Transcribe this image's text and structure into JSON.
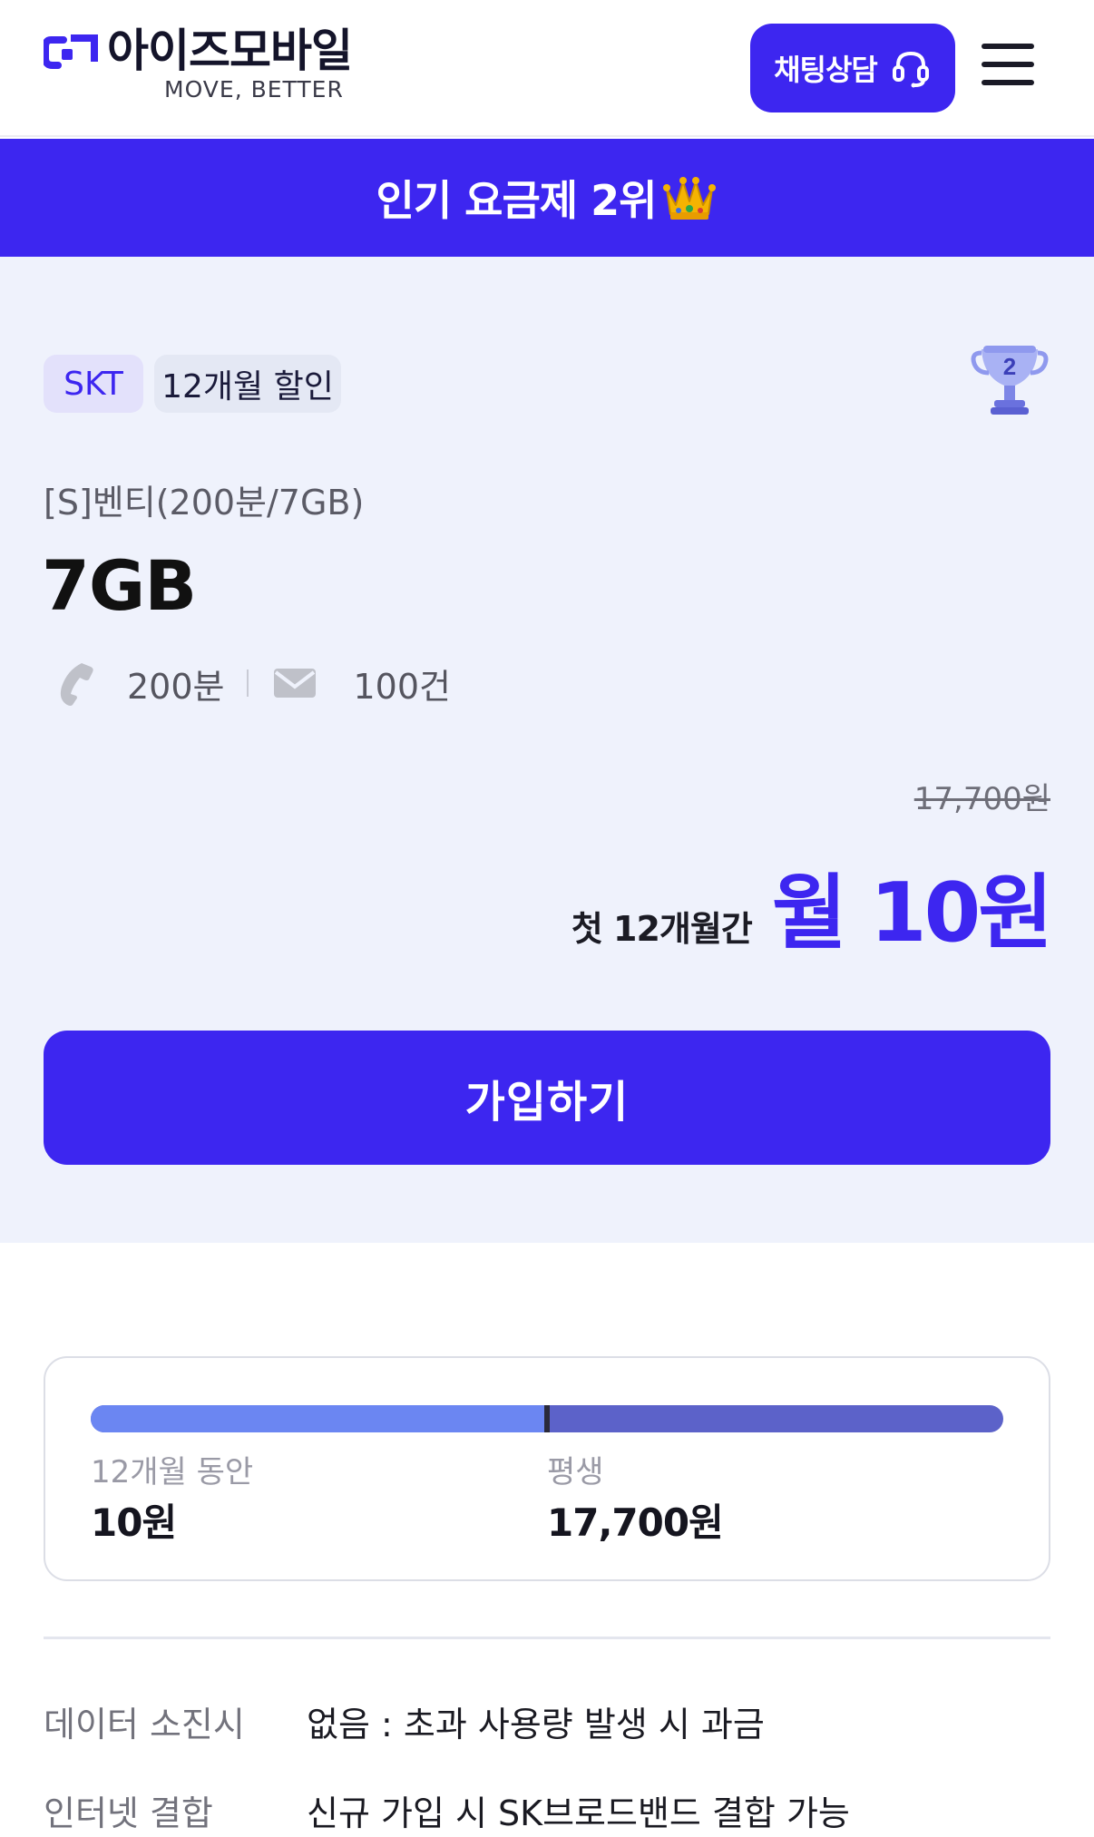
{
  "header": {
    "logo_text": "아이즈모바일",
    "logo_tagline": "MOVE, BETTER",
    "chat_button": "채팅상담",
    "chat_icon": "headset-icon",
    "menu_icon": "hamburger-menu-icon"
  },
  "banner": {
    "text": "인기 요금제 2위",
    "emoji_icon": "crown-icon"
  },
  "plan": {
    "carrier_tag": "SKT",
    "discount_tag": "12개월 할인",
    "rank_icon": "trophy-icon",
    "rank": "2",
    "name": "[S]벤티(200분/7GB)",
    "data": "7GB",
    "voice": "200분",
    "sms": "100건",
    "original_price": "17,700원",
    "promo_label": "첫 12개월간",
    "promo_price": "월 10원",
    "join_button": "가입하기"
  },
  "breakdown": {
    "first_period_fraction": 0.5,
    "first_label": "12개월 동안",
    "first_value": "10원",
    "second_label": "평생",
    "second_value": "17,700원",
    "colors": {
      "first": "#6b86f2",
      "second": "#5c62c9"
    }
  },
  "info": [
    {
      "key": "데이터 소진시",
      "value": "없음 : 초과 사용량 발생 시 과금"
    },
    {
      "key": "인터넷 결합",
      "value": "신규 가입 시 SK브로드밴드 결합 가능"
    }
  ],
  "colors": {
    "accent": "#3d26f0",
    "card_bg": "#eff2fc"
  }
}
